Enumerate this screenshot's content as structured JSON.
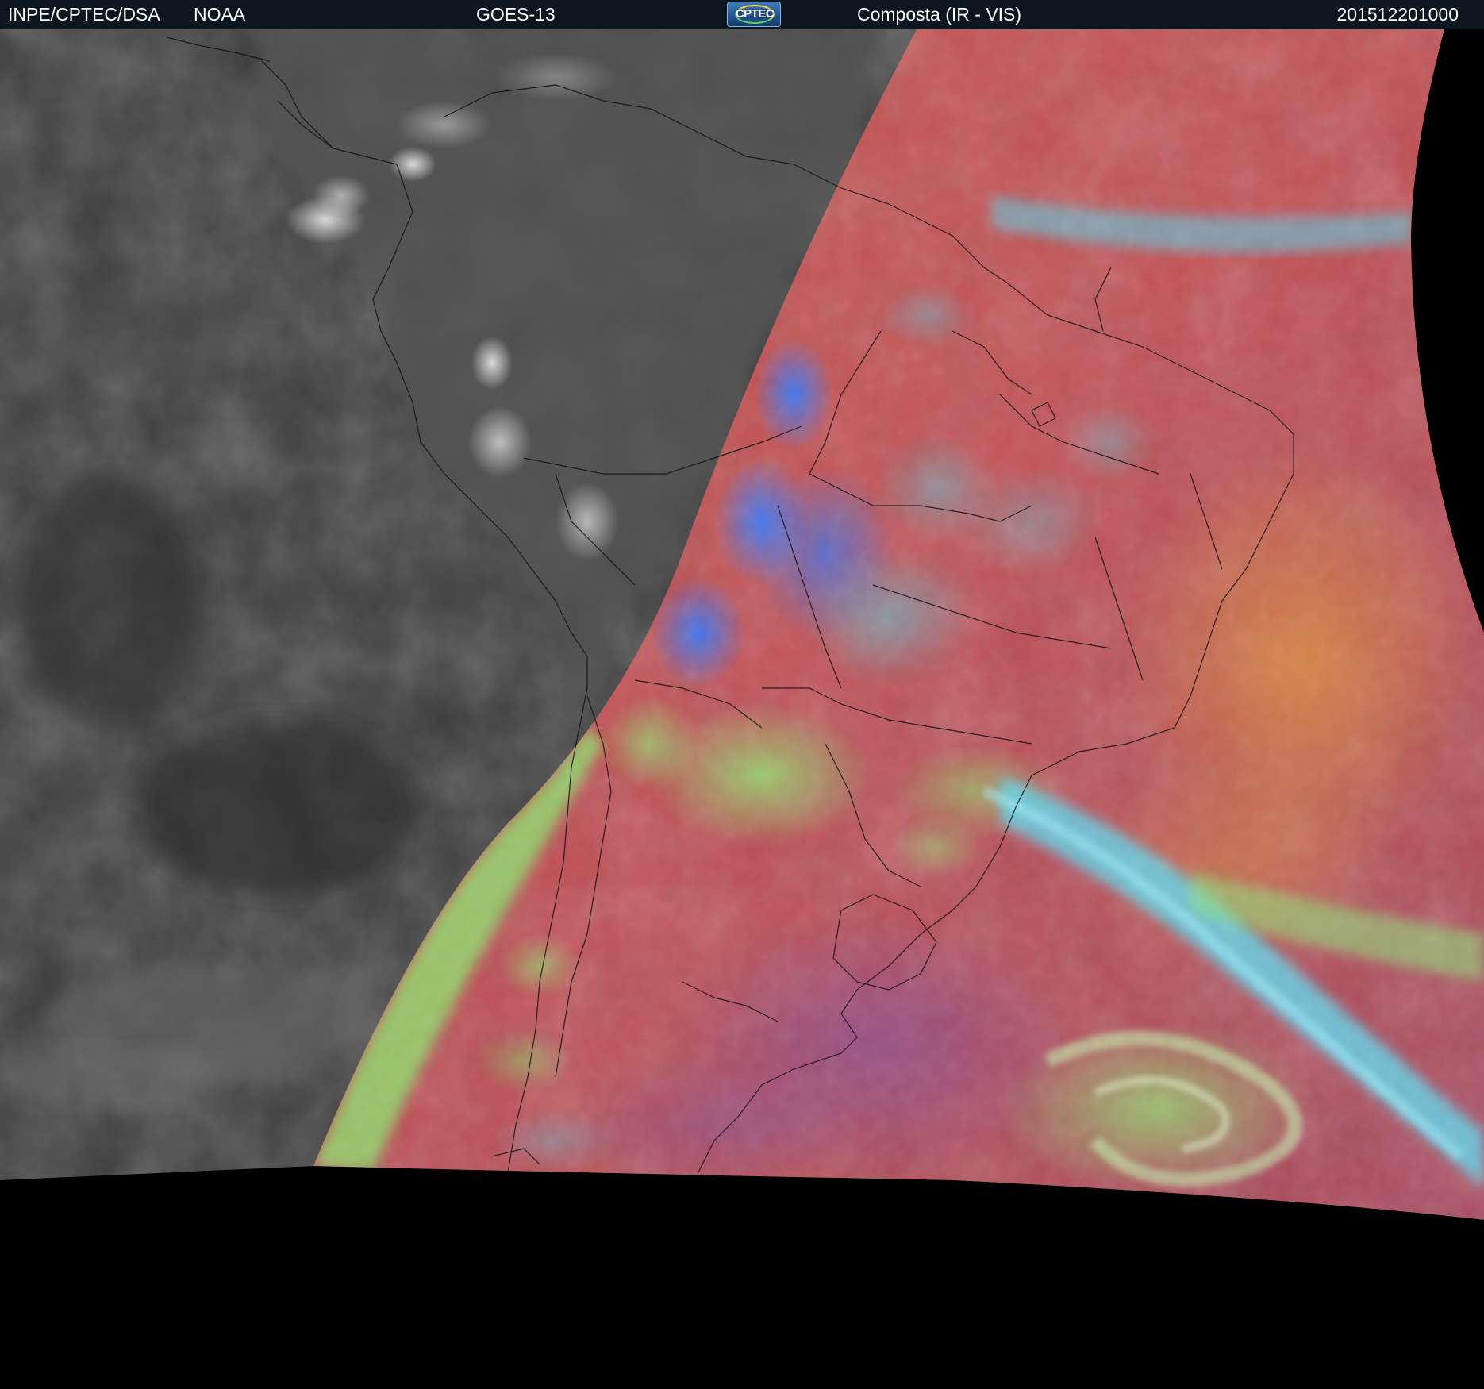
{
  "header": {
    "agency": "INPE/CPTEC/DSA",
    "source": "NOAA",
    "satellite": "GOES-13",
    "logo_text": "CPTEC",
    "product": "Composta (IR - VIS)",
    "timestamp": "201512201000"
  },
  "colors": {
    "header_bg": "#0c1620",
    "ir_gray": "#3a3a3a",
    "composite_red": "#c84e44",
    "cloud_cyan": "#4fd2e6",
    "cloud_green": "#8fea72",
    "cloud_blue": "#3e7cf2",
    "space_black": "#000000"
  },
  "image": {
    "description_icon": "satellite-image-icon"
  }
}
